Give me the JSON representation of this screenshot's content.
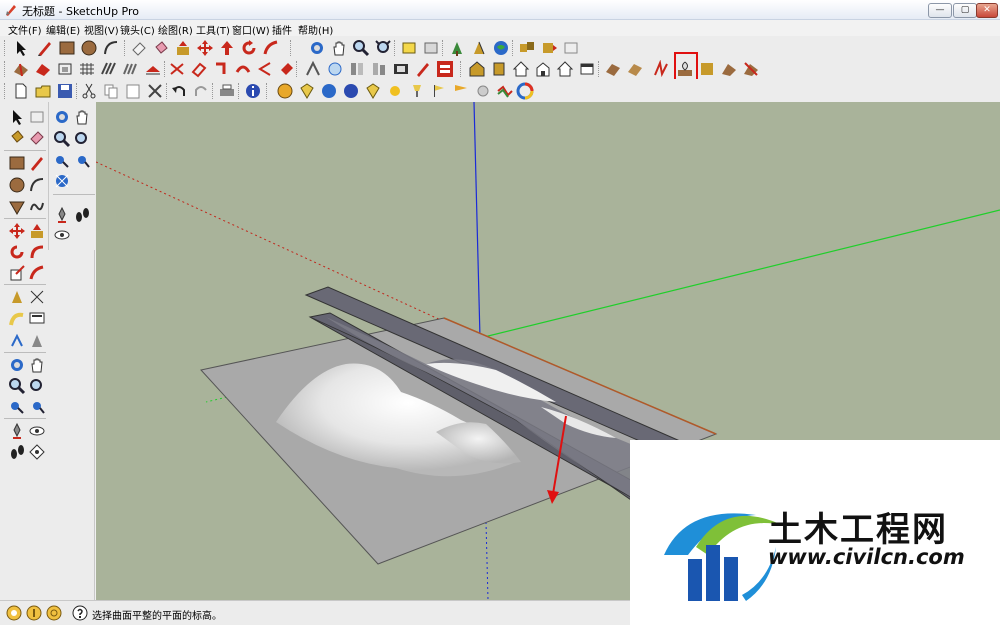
{
  "window": {
    "title": "无标题 - SketchUp Pro",
    "controls": {
      "minimize": "—",
      "maximize": "▢",
      "close": "✕"
    }
  },
  "menu": [
    "文件(F)",
    "编辑(E)",
    "视图(V)",
    "镜头(C)",
    "绘图(R)",
    "工具(T)",
    "窗口(W)",
    "插件",
    "帮助(H)"
  ],
  "status": {
    "hint": "选择曲面平整的平面的标高。"
  },
  "watermark": {
    "brand": "土木工程网",
    "url": "www.civilcn.com"
  },
  "colors": {
    "viewport_bg": "#a9b39a",
    "axis_blue": "#1a2ad8",
    "axis_green": "#1fcf2a",
    "axis_red": "#c0281c",
    "highlight": "#e01010"
  },
  "toolbars": {
    "row1": [
      "select-icon",
      "pencil-icon",
      "rectangle-icon",
      "circle-icon",
      "arc-icon",
      "eraser-icon",
      "paint-bucket-icon",
      "push-pull-icon",
      "move-icon",
      "rotate-icon",
      "follow-me-icon",
      "orbit-icon",
      "pan-icon",
      "zoom-icon",
      "zoom-extents-icon",
      "section-plane-icon",
      "component-icon",
      "tape-icon",
      "text-icon",
      "geo-location-icon"
    ],
    "row2": [
      "sandbox-from-contours-icon",
      "sandbox-from-scratch-icon",
      "smoove-icon",
      "stamp-icon",
      "drape-icon",
      "add-detail-icon",
      "flip-edge-icon",
      "house-front-icon",
      "house-back-icon",
      "house-left-icon",
      "house-right-icon",
      "house-top-icon",
      "house-iso-icon",
      "texture-icon",
      "flatten-icon"
    ],
    "row3": [
      "new-icon",
      "open-icon",
      "save-icon",
      "cut-icon",
      "copy-icon",
      "paste-icon",
      "delete-icon",
      "undo-icon",
      "redo-icon",
      "print-icon",
      "model-info-icon",
      "materials-icon",
      "styles-icon",
      "shadows-icon",
      "fog-icon",
      "sun-icon",
      "layers-icon",
      "scenes-icon",
      "outliner-icon",
      "soften-icon"
    ]
  }
}
